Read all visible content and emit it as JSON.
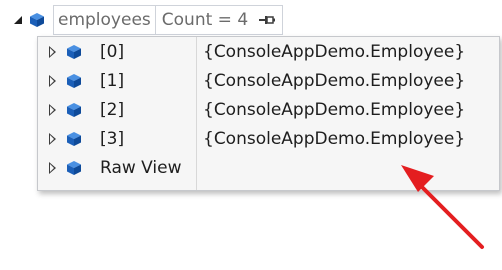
{
  "datatip": {
    "variable_name": "employees",
    "count_text": "Count = 4",
    "pin_icon": "pin-icon",
    "expanded_icon": "expanded-triangle-icon",
    "object_icon": "object-cube-icon"
  },
  "children": [
    {
      "name": "[0]",
      "value": "{ConsoleAppDemo.Employee}"
    },
    {
      "name": "[1]",
      "value": "{ConsoleAppDemo.Employee}"
    },
    {
      "name": "[2]",
      "value": "{ConsoleAppDemo.Employee}"
    },
    {
      "name": "[3]",
      "value": "{ConsoleAppDemo.Employee}"
    },
    {
      "name": "Raw View",
      "value": ""
    }
  ],
  "colors": {
    "cube_blue": "#1b6ac9",
    "annotation_arrow": "#e41e20",
    "panel_background": "#f6f6f6"
  }
}
